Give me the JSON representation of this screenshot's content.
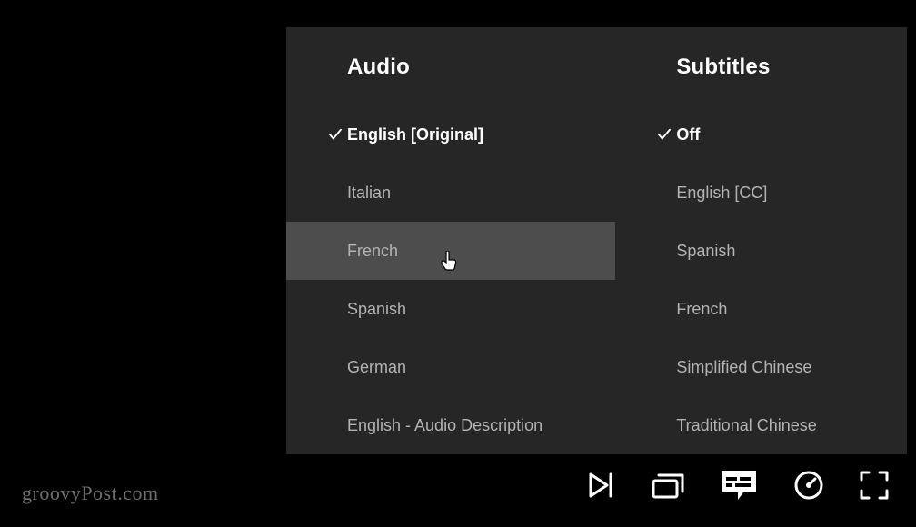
{
  "audio": {
    "header": "Audio",
    "options": [
      {
        "label": "English [Original]",
        "selected": true,
        "hovered": false
      },
      {
        "label": "Italian",
        "selected": false,
        "hovered": false
      },
      {
        "label": "French",
        "selected": false,
        "hovered": true
      },
      {
        "label": "Spanish",
        "selected": false,
        "hovered": false
      },
      {
        "label": "German",
        "selected": false,
        "hovered": false
      },
      {
        "label": "English - Audio Description",
        "selected": false,
        "hovered": false
      }
    ]
  },
  "subtitles": {
    "header": "Subtitles",
    "options": [
      {
        "label": "Off",
        "selected": true,
        "hovered": false
      },
      {
        "label": "English [CC]",
        "selected": false,
        "hovered": false
      },
      {
        "label": "Spanish",
        "selected": false,
        "hovered": false
      },
      {
        "label": "French",
        "selected": false,
        "hovered": false
      },
      {
        "label": "Simplified Chinese",
        "selected": false,
        "hovered": false
      },
      {
        "label": "Traditional Chinese",
        "selected": false,
        "hovered": false
      }
    ]
  },
  "watermark": "groovyPost.com"
}
